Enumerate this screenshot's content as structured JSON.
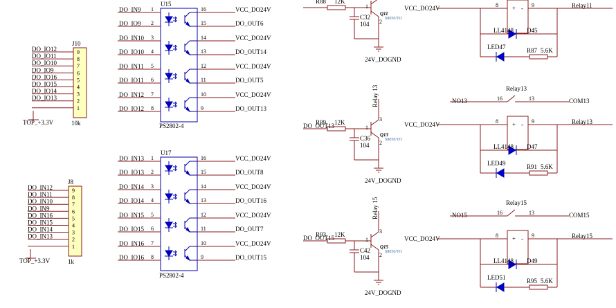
{
  "u15": {
    "ref": "U15",
    "part": "PS2802-4"
  },
  "u17": {
    "ref": "U17",
    "part": "PS2802-4"
  },
  "opto_rows": [
    {
      "in": "DO_IN9",
      "in_pin": "1",
      "out_pin": "16",
      "out": "VCC_DO24V"
    },
    {
      "in": "DO_IO9",
      "in_pin": "2",
      "out_pin": "15",
      "out": "DO_OUT6"
    },
    {
      "in": "DO_IN10",
      "in_pin": "3",
      "out_pin": "14",
      "out": "VCC_DO24V"
    },
    {
      "in": "DO_IO10",
      "in_pin": "4",
      "out_pin": "13",
      "out": "DO_OUT14"
    },
    {
      "in": "DO_IN11",
      "in_pin": "5",
      "out_pin": "12",
      "out": "VCC_DO24V"
    },
    {
      "in": "DO_IO11",
      "in_pin": "6",
      "out_pin": "11",
      "out": "DO_OUT5"
    },
    {
      "in": "DO_IN12",
      "in_pin": "7",
      "out_pin": "10",
      "out": "VCC_DO24V"
    },
    {
      "in": "DO_IO12",
      "in_pin": "8",
      "out_pin": "9",
      "out": "DO_OUT13"
    },
    {
      "in": "DO_IN13",
      "in_pin": "1",
      "out_pin": "16",
      "out": "VCC_DO24V"
    },
    {
      "in": "DO_IO13",
      "in_pin": "2",
      "out_pin": "15",
      "out": "DO_OUT8"
    },
    {
      "in": "DO_IN14",
      "in_pin": "3",
      "out_pin": "14",
      "out": "VCC_DO24V"
    },
    {
      "in": "DO_IO14",
      "in_pin": "4",
      "out_pin": "13",
      "out": "DO_OUT16"
    },
    {
      "in": "DO_IN15",
      "in_pin": "5",
      "out_pin": "12",
      "out": "VCC_DO24V"
    },
    {
      "in": "DO_IO15",
      "in_pin": "6",
      "out_pin": "11",
      "out": "DO_OUT7"
    },
    {
      "in": "DO_IN16",
      "in_pin": "7",
      "out_pin": "10",
      "out": "VCC_DO24V"
    },
    {
      "in": "DO_IO16",
      "in_pin": "8",
      "out_pin": "9",
      "out": "DO_OUT15"
    }
  ],
  "j10": {
    "ref": "J10",
    "value": "10k",
    "power": "TOP_+3.3V",
    "pins": [
      {
        "net": "DO_IO12",
        "num": "9"
      },
      {
        "net": "DO_IO11",
        "num": "8"
      },
      {
        "net": "DO_IO10",
        "num": "7"
      },
      {
        "net": "DO_IO9",
        "num": "6"
      },
      {
        "net": "DO_IO16",
        "num": "5"
      },
      {
        "net": "DO_IO15",
        "num": "4"
      },
      {
        "net": "DO_IO14",
        "num": "3"
      },
      {
        "net": "DO_IO13",
        "num": "2"
      },
      {
        "net": "",
        "num": "1"
      }
    ]
  },
  "j8": {
    "ref": "J8",
    "value": "1k",
    "power": "TOP_+3.3V",
    "pins": [
      {
        "net": "DO_IN12",
        "num": "9"
      },
      {
        "net": "DO_IN11",
        "num": "8"
      },
      {
        "net": "DO_IN10",
        "num": "7"
      },
      {
        "net": "DO_IN9",
        "num": "6"
      },
      {
        "net": "DO_IN16",
        "num": "5"
      },
      {
        "net": "DO_IN15",
        "num": "4"
      },
      {
        "net": "DO_IN14",
        "num": "3"
      },
      {
        "net": "DO_IN13",
        "num": "2"
      },
      {
        "net": "",
        "num": "1"
      }
    ]
  },
  "stages": [
    {
      "input": "",
      "res": "R88",
      "res_val": "12K",
      "cap": "C32",
      "cap_val": "104",
      "q": "Q11",
      "q_part": "S8050/TO",
      "vcc": "VCC_DO24V",
      "gnd": "24V_DOGND",
      "relay_net": ""
    },
    {
      "input": "DO_OUT13",
      "res": "R89",
      "res_val": "12K",
      "cap": "C36",
      "cap_val": "104",
      "q": "Q13",
      "q_part": "S8050/TO",
      "vcc": "VCC_DO24V",
      "gnd": "24V_DOGND",
      "relay_net": "Relay 13"
    },
    {
      "input": "DO_OUT15",
      "res": "R93",
      "res_val": "12K",
      "cap": "C42",
      "cap_val": "104",
      "q": "Q15",
      "q_part": "S8050/TO",
      "vcc": "VCC_DO24V",
      "gnd": "24V_DOGND",
      "relay_net": "Relay 15"
    }
  ],
  "relays": [
    {
      "ref": "",
      "no": "",
      "com": "",
      "pin_a": "8",
      "pin_b": "9",
      "pin_no": "",
      "pin_com": "",
      "out": "Relay11",
      "diode": "LL4148",
      "diode_ref": "D45",
      "led": "LED47",
      "res": "R87",
      "res_val": "5.6K"
    },
    {
      "ref": "Relay13",
      "no": "NO13",
      "com": "COM13",
      "pin_a": "8",
      "pin_b": "9",
      "pin_no": "16",
      "pin_com": "13",
      "out": "Relay13",
      "diode": "LL4148",
      "diode_ref": "D47",
      "led": "LED49",
      "res": "R91",
      "res_val": "5.6K"
    },
    {
      "ref": "Relay15",
      "no": "NO15",
      "com": "COM15",
      "pin_a": "8",
      "pin_b": "9",
      "pin_no": "16",
      "pin_com": "13",
      "out": "Relay15",
      "diode": "LL4148",
      "diode_ref": "D49",
      "led": "LED51",
      "res": "R95",
      "res_val": "5.6K"
    }
  ]
}
